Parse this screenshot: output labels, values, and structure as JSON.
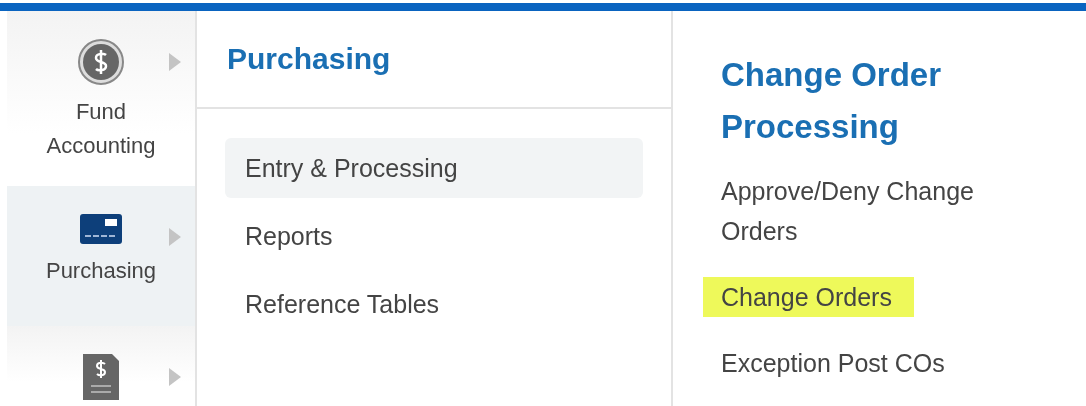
{
  "sidebar": {
    "items": [
      {
        "kind": "coin",
        "label": "Fund Accounting",
        "selected": false
      },
      {
        "kind": "card",
        "label": "Purchasing",
        "selected": true
      },
      {
        "kind": "invoice",
        "selected": false
      }
    ]
  },
  "submenu": {
    "title": "Purchasing",
    "items": [
      {
        "label": "Entry & Processing",
        "selected": true
      },
      {
        "label": "Reports",
        "selected": false
      },
      {
        "label": "Reference Tables",
        "selected": false
      }
    ]
  },
  "panel": {
    "title": "Change Order Processing",
    "links": [
      {
        "label": "Approve/Deny Change Orders",
        "highlighted": false
      },
      {
        "label": "Change Orders",
        "highlighted": true
      },
      {
        "label": "Exception Post COs",
        "highlighted": false
      }
    ]
  }
}
